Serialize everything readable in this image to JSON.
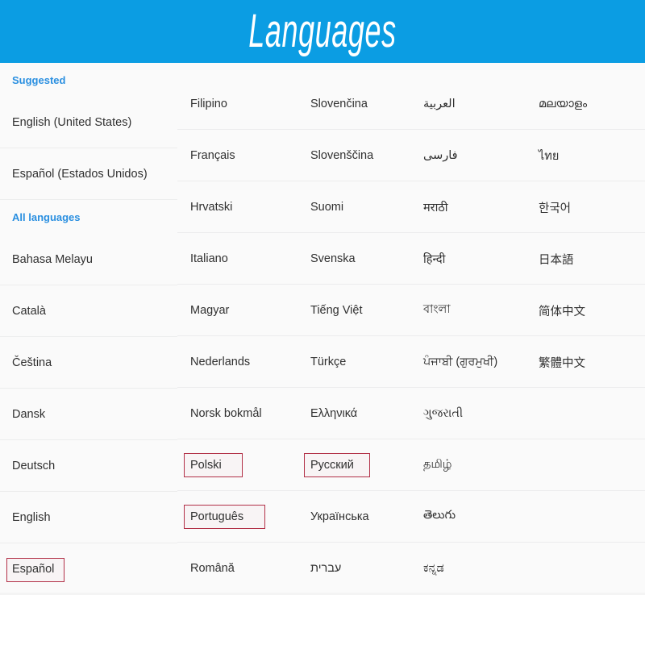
{
  "header": {
    "title": "Languages",
    "background_color": "#0b9de3",
    "text_color": "#ffffff"
  },
  "colors": {
    "accent_blue": "#2a8fe0",
    "page_background": "#fafafa",
    "row_divider": "#ececed",
    "highlight_border": "#b23047",
    "text": "#303030"
  },
  "sidebar": {
    "sections": [
      {
        "type": "header",
        "label": "Suggested"
      },
      {
        "type": "item",
        "label": "English (United States)",
        "highlighted": false
      },
      {
        "type": "item",
        "label": "Español (Estados Unidos)",
        "highlighted": false
      },
      {
        "type": "header",
        "label": "All languages"
      },
      {
        "type": "item",
        "label": "Bahasa Melayu",
        "highlighted": false
      },
      {
        "type": "item",
        "label": "Català",
        "highlighted": false
      },
      {
        "type": "item",
        "label": "Čeština",
        "highlighted": false
      },
      {
        "type": "item",
        "label": "Dansk",
        "highlighted": false
      },
      {
        "type": "item",
        "label": "Deutsch",
        "highlighted": false
      },
      {
        "type": "item",
        "label": "English",
        "highlighted": false
      },
      {
        "type": "item",
        "label": "Español",
        "highlighted": true
      }
    ]
  },
  "grid": {
    "columns": [
      {
        "index": 1,
        "items": [
          {
            "label": "Filipino",
            "highlighted": false
          },
          {
            "label": "Français",
            "highlighted": false
          },
          {
            "label": "Hrvatski",
            "highlighted": false
          },
          {
            "label": "Italiano",
            "highlighted": false
          },
          {
            "label": "Magyar",
            "highlighted": false
          },
          {
            "label": "Nederlands",
            "highlighted": false
          },
          {
            "label": "Norsk bokmål",
            "highlighted": false
          },
          {
            "label": "Polski",
            "highlighted": true
          },
          {
            "label": "Português",
            "highlighted": true
          },
          {
            "label": "Română",
            "highlighted": false
          }
        ]
      },
      {
        "index": 2,
        "items": [
          {
            "label": "Slovenčina",
            "highlighted": false
          },
          {
            "label": "Slovenščina",
            "highlighted": false
          },
          {
            "label": "Suomi",
            "highlighted": false
          },
          {
            "label": "Svenska",
            "highlighted": false
          },
          {
            "label": "Tiếng Việt",
            "highlighted": false
          },
          {
            "label": "Türkçe",
            "highlighted": false
          },
          {
            "label": "Ελληνικά",
            "highlighted": false
          },
          {
            "label": "Русский",
            "highlighted": true
          },
          {
            "label": "Українська",
            "highlighted": false
          },
          {
            "label": "עברית",
            "highlighted": false
          }
        ]
      },
      {
        "index": 3,
        "items": [
          {
            "label": "العربية",
            "highlighted": false
          },
          {
            "label": "فارسی",
            "highlighted": false
          },
          {
            "label": "मराठी",
            "highlighted": false
          },
          {
            "label": "हिन्दी",
            "highlighted": false
          },
          {
            "label": "বাংলা",
            "highlighted": false
          },
          {
            "label": "ਪੰਜਾਬੀ (ਗੁਰਮੁਖੀ)",
            "highlighted": false
          },
          {
            "label": "ગુજરાતી",
            "highlighted": false
          },
          {
            "label": "தமிழ்",
            "highlighted": false
          },
          {
            "label": "తెలుగు",
            "highlighted": false
          },
          {
            "label": "ಕನ್ನಡ",
            "highlighted": false
          }
        ]
      },
      {
        "index": 4,
        "items": [
          {
            "label": "മലയാളം",
            "highlighted": false
          },
          {
            "label": "ไทย",
            "highlighted": false
          },
          {
            "label": "한국어",
            "highlighted": false
          },
          {
            "label": "日本語",
            "highlighted": false
          },
          {
            "label": "简体中文",
            "highlighted": false
          },
          {
            "label": "繁體中文",
            "highlighted": false
          },
          {
            "label": "",
            "highlighted": false
          },
          {
            "label": "",
            "highlighted": false
          },
          {
            "label": "",
            "highlighted": false
          },
          {
            "label": "",
            "highlighted": false
          }
        ]
      }
    ]
  }
}
